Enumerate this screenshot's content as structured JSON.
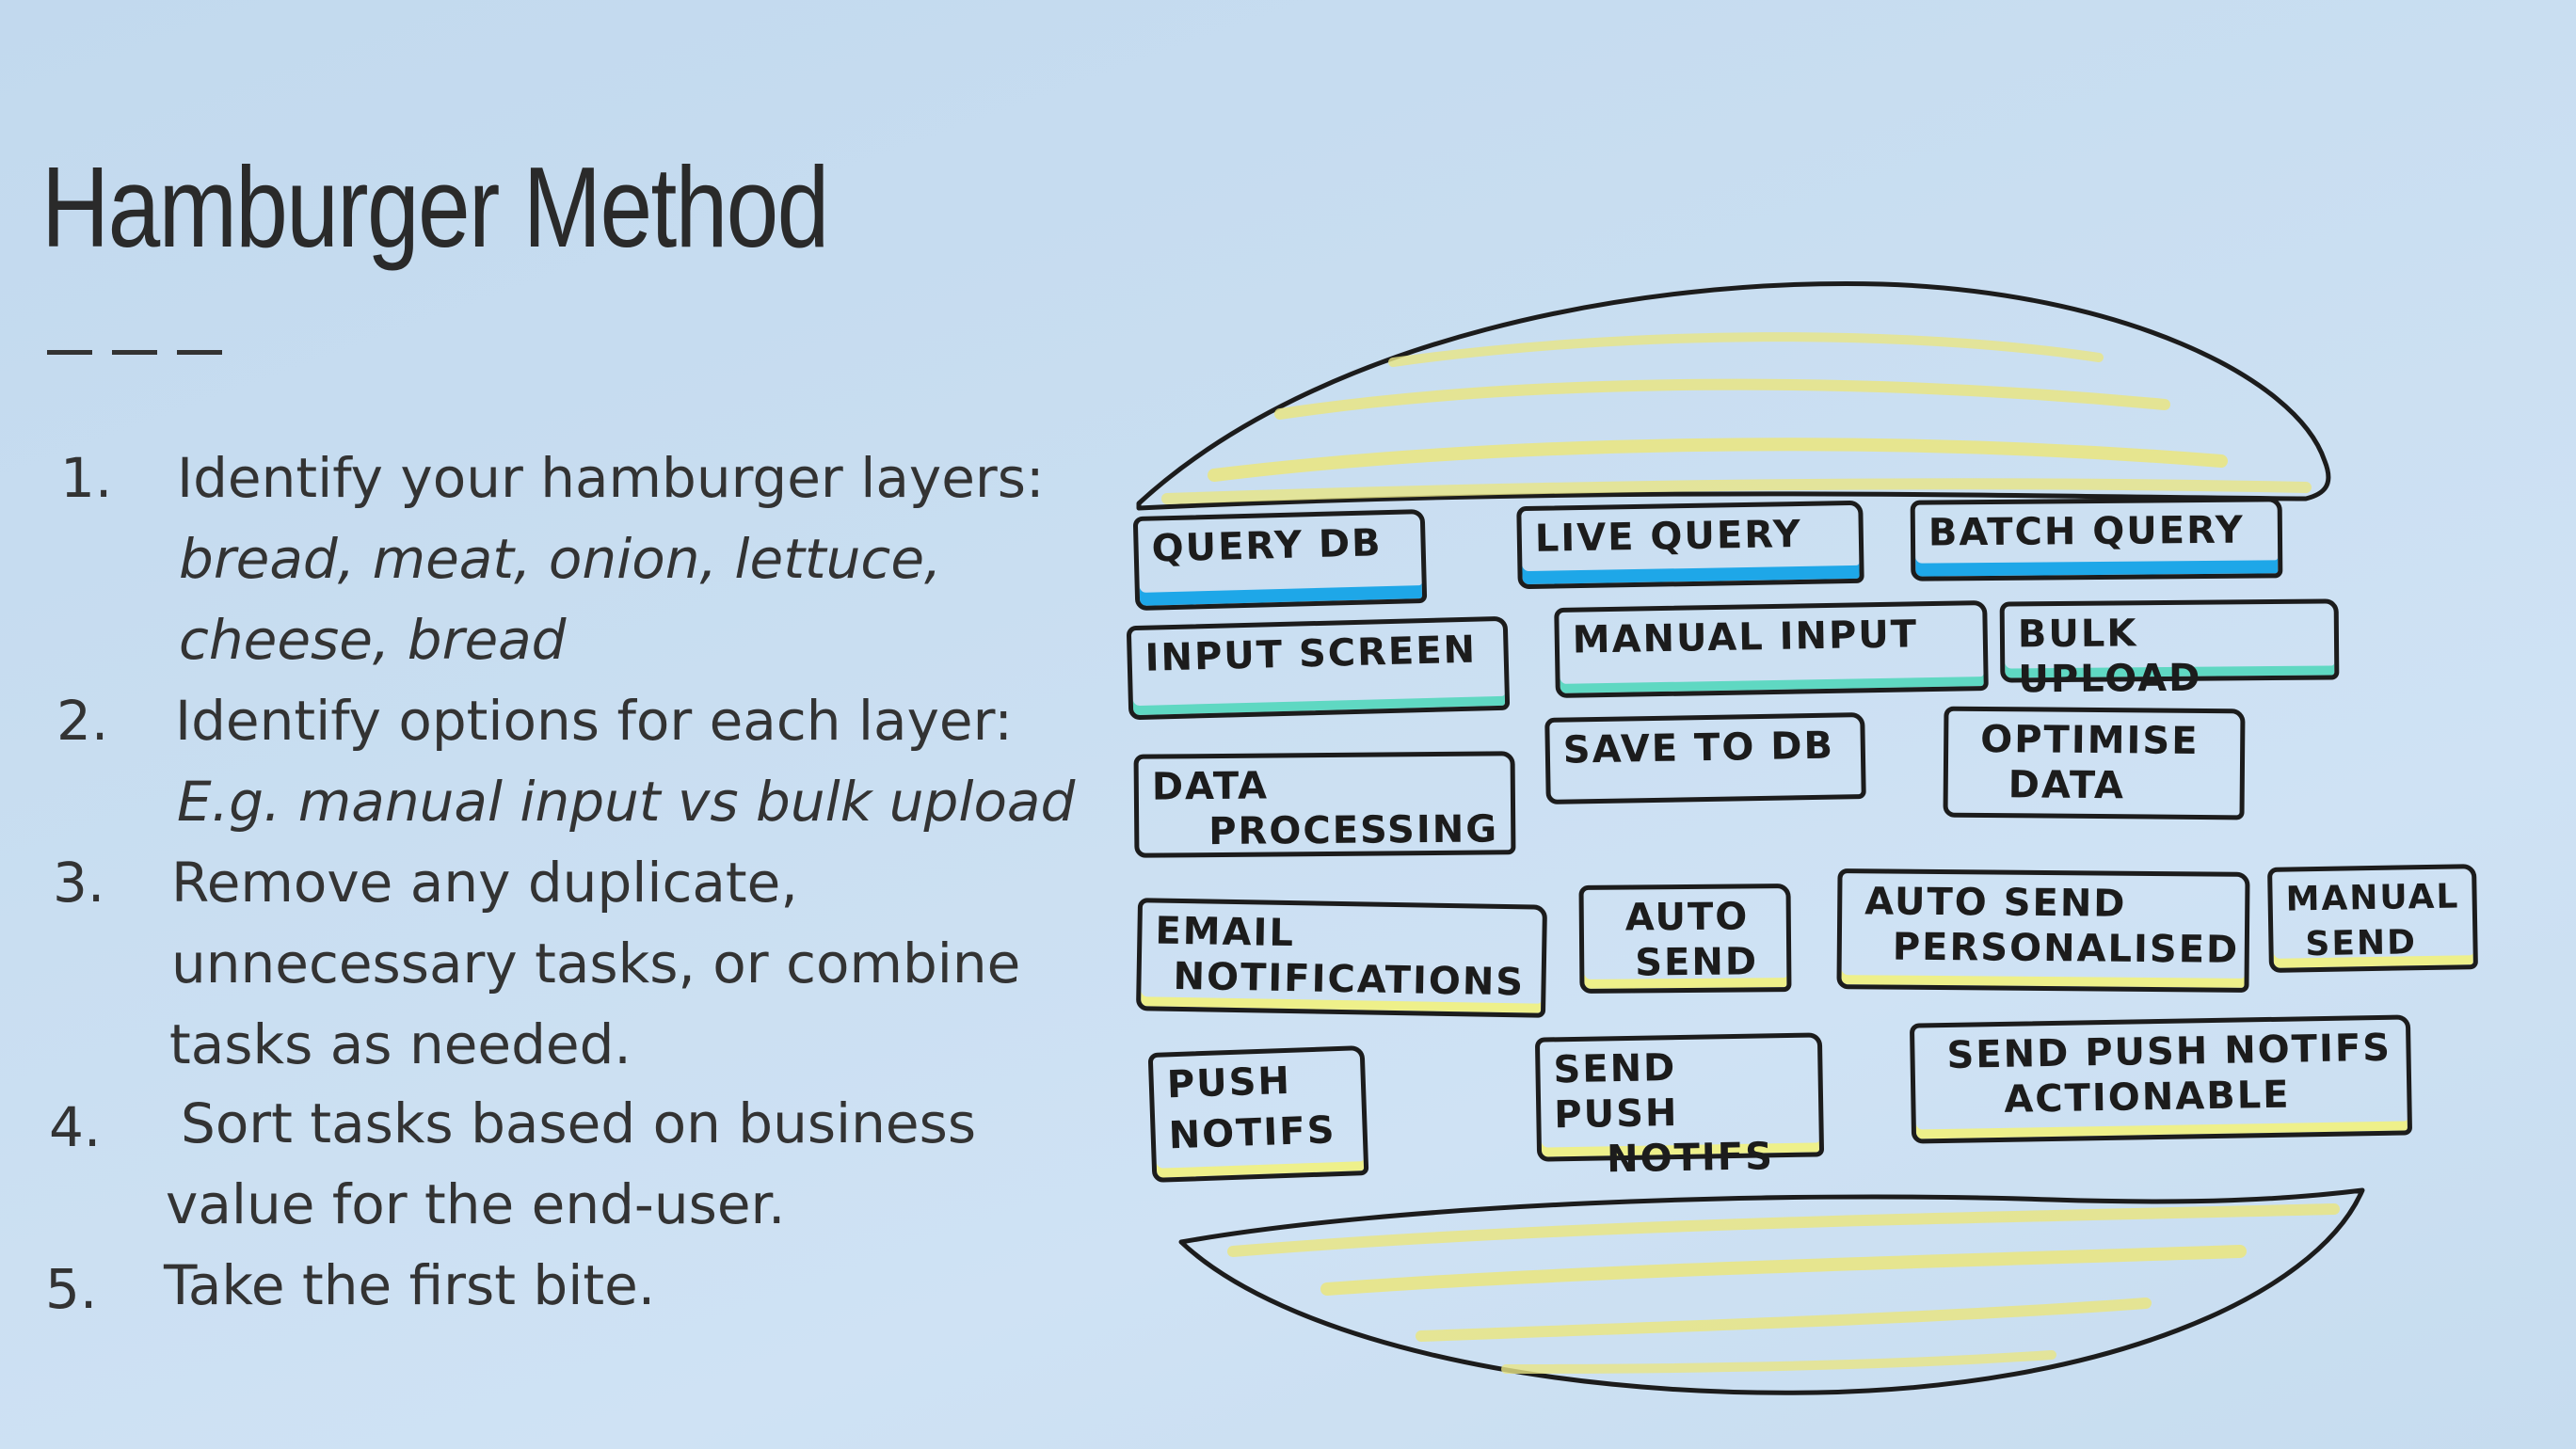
{
  "title": "Hamburger Method",
  "steps": [
    {
      "num": "1.",
      "lines": [
        "Identify your hamburger layers:"
      ],
      "italic_lines": [
        "bread, meat, onion, lettuce,",
        "cheese, bread"
      ]
    },
    {
      "num": "2.",
      "lines": [
        "Identify options for each layer:"
      ],
      "italic_lines": [
        "E.g. manual input vs bulk upload"
      ]
    },
    {
      "num": "3.",
      "lines": [
        "Remove any duplicate,",
        "unnecessary tasks, or combine",
        "tasks as needed."
      ],
      "italic_lines": []
    },
    {
      "num": "4.",
      "lines": [
        "Sort tasks based on business",
        "value for the end-user."
      ],
      "italic_lines": []
    },
    {
      "num": "5.",
      "lines": [
        "Take the first bite."
      ],
      "italic_lines": []
    }
  ],
  "burger": {
    "bun_color": "#e9e584",
    "outline_color": "#1c1c1c",
    "layers": [
      {
        "cards": [
          {
            "lines": [
              "QUERY DB"
            ],
            "highlight": "#1ea7e8"
          },
          {
            "lines": [
              "LIVE QUERY"
            ],
            "highlight": "#1ea7e8"
          },
          {
            "lines": [
              "BATCH QUERY"
            ],
            "highlight": "#1ea7e8"
          }
        ]
      },
      {
        "cards": [
          {
            "lines": [
              "INPUT SCREEN"
            ],
            "highlight": "#5fd8c2"
          },
          {
            "lines": [
              "MANUAL INPUT"
            ],
            "highlight": "#5fd8c2"
          },
          {
            "lines": [
              "BULK UPLOAD"
            ],
            "highlight": "#5fd8c2"
          }
        ]
      },
      {
        "cards": [
          {
            "lines": [
              "DATA",
              "PROCESSING"
            ],
            "highlight": "none"
          },
          {
            "lines": [
              "SAVE TO DB"
            ],
            "highlight": "none"
          },
          {
            "lines": [
              "OPTIMISE",
              "DATA"
            ],
            "highlight": "none"
          }
        ]
      },
      {
        "cards": [
          {
            "lines": [
              "EMAIL",
              "NOTIFICATIONS"
            ],
            "highlight": "#eef08a"
          },
          {
            "lines": [
              "AUTO",
              "SEND"
            ],
            "highlight": "#eef08a"
          },
          {
            "lines": [
              "AUTO SEND",
              "PERSONALISED"
            ],
            "highlight": "#eef08a"
          },
          {
            "lines": [
              "MANUAL",
              "SEND"
            ],
            "highlight": "#eef08a"
          }
        ]
      },
      {
        "cards": [
          {
            "lines": [
              "PUSH",
              "NOTIFS"
            ],
            "highlight": "#eef08a"
          },
          {
            "lines": [
              "SEND PUSH",
              "NOTIFS"
            ],
            "highlight": "#eef08a"
          },
          {
            "lines": [
              "SEND PUSH NOTIFS",
              "ACTIONABLE"
            ],
            "highlight": "#eef08a"
          }
        ]
      }
    ]
  }
}
